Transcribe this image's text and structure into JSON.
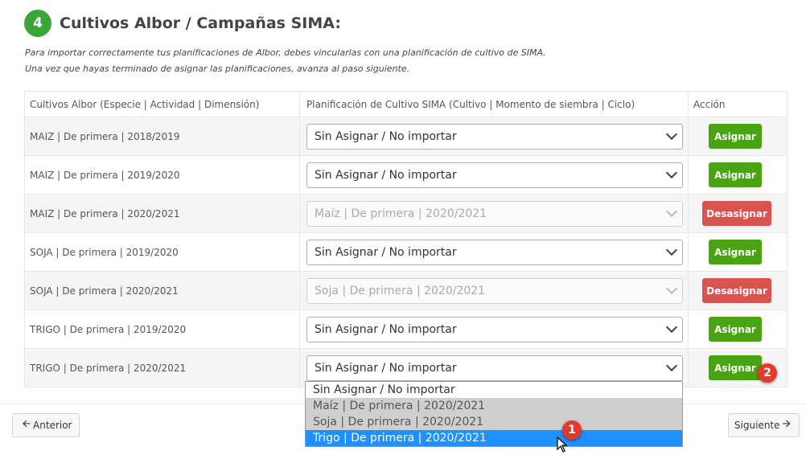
{
  "step": {
    "number": "4",
    "title": "Cultivos Albor / Campañas SIMA:"
  },
  "intro": {
    "line1": "Para importar correctamente tus planificaciones de Albor, debes vincularlas con una planificación de cultivo de SIMA.",
    "line2": "Una vez que hayas terminado de asignar las planificaciones, avanza al paso siguiente."
  },
  "table": {
    "headers": [
      "Cultivos Albor (Especie | Actividad | Dimensión)",
      "Planificación de Cultivo SIMA (Cultivo | Momento de siembra | Ciclo)",
      "Acción"
    ],
    "rows": [
      {
        "crop": "MAIZ | De primera | 2018/2019",
        "plan": "Sin Asignar / No importar",
        "action": "Asignar"
      },
      {
        "crop": "MAIZ | De primera | 2019/2020",
        "plan": "Sin Asignar / No importar",
        "action": "Asignar"
      },
      {
        "crop": "MAIZ | De primera | 2020/2021",
        "plan": "Maíz | De primera | 2020/2021",
        "action": "Desasignar"
      },
      {
        "crop": "SOJA | De primera | 2019/2020",
        "plan": "Sin Asignar / No importar",
        "action": "Asignar"
      },
      {
        "crop": "SOJA | De primera | 2020/2021",
        "plan": "Soja | De primera | 2020/2021",
        "action": "Desasignar"
      },
      {
        "crop": "TRIGO | De primera | 2019/2020",
        "plan": "Sin Asignar / No importar",
        "action": "Asignar"
      },
      {
        "crop": "TRIGO | De primera | 2020/2021",
        "plan": "Sin Asignar / No importar",
        "action": "Asignar"
      }
    ]
  },
  "dropdown": {
    "options": [
      "Sin Asignar / No importar",
      "Maíz | De primera | 2020/2021",
      "Soja | De primera | 2020/2021",
      "Trigo | De primera | 2020/2021"
    ],
    "highlighted": "Trigo | De primera | 2020/2021"
  },
  "nav": {
    "prev": "Anterior",
    "next": "Siguiente"
  },
  "badges": {
    "one": "1",
    "two": "2"
  },
  "colors": {
    "green": "#4aa313",
    "red": "#d9534f",
    "step": "#3aa63a",
    "highlight": "#1e90ff",
    "badge": "#e23b2e"
  }
}
